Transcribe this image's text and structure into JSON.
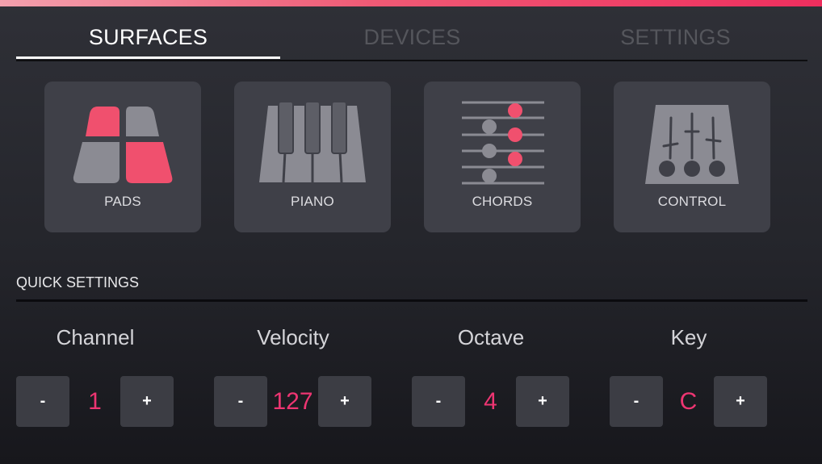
{
  "accent_color": "#ee3572",
  "tabs": [
    {
      "label": "SURFACES",
      "active": true
    },
    {
      "label": "DEVICES",
      "active": false
    },
    {
      "label": "SETTINGS",
      "active": false
    }
  ],
  "surfaces": [
    {
      "label": "PADS",
      "icon": "pads-icon"
    },
    {
      "label": "PIANO",
      "icon": "piano-icon"
    },
    {
      "label": "CHORDS",
      "icon": "chords-icon"
    },
    {
      "label": "CONTROL",
      "icon": "control-icon"
    }
  ],
  "quick_settings": {
    "title": "QUICK SETTINGS",
    "items": [
      {
        "label": "Channel",
        "value": "1",
        "minus": "-",
        "plus": "+"
      },
      {
        "label": "Velocity",
        "value": "127",
        "minus": "-",
        "plus": "+"
      },
      {
        "label": "Octave",
        "value": "4",
        "minus": "-",
        "plus": "+"
      },
      {
        "label": "Key",
        "value": "C",
        "minus": "-",
        "plus": "+"
      }
    ]
  }
}
